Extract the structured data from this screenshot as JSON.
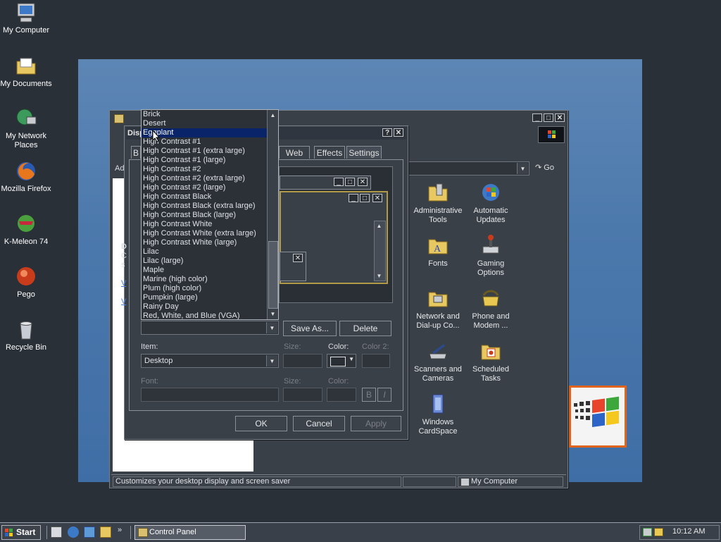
{
  "desktop": {
    "icons": [
      {
        "label": "My Computer",
        "icon": "my-computer-icon"
      },
      {
        "label": "My Documents",
        "icon": "my-documents-icon"
      },
      {
        "label": "My Network Places",
        "icon": "network-places-icon"
      },
      {
        "label": "Mozilla Firefox",
        "icon": "firefox-icon"
      },
      {
        "label": "K-Meleon 74",
        "icon": "k-meleon-icon"
      },
      {
        "label": "Pego",
        "icon": "pego-icon"
      },
      {
        "label": "Recycle Bin",
        "icon": "recycle-bin-icon"
      }
    ]
  },
  "control_panel": {
    "title": "Control Panel",
    "address_go": "Go",
    "address_label": "Ad",
    "icons": [
      {
        "label": "Administrative Tools",
        "icon": "admin-tools-icon"
      },
      {
        "label": "Automatic Updates",
        "icon": "automatic-updates-icon"
      },
      {
        "label": "Fonts",
        "icon": "fonts-icon"
      },
      {
        "label": "Gaming Options",
        "icon": "gaming-options-icon"
      },
      {
        "label": "Network and Dial-up Co...",
        "icon": "network-dialup-icon"
      },
      {
        "label": "Phone and Modem ...",
        "icon": "phone-modem-icon"
      },
      {
        "label": "Scanners and Cameras",
        "icon": "scanners-cameras-icon"
      },
      {
        "label": "Scheduled Tasks",
        "icon": "scheduled-tasks-icon"
      },
      {
        "label": "Windows CardSpace",
        "icon": "cardspace-icon"
      }
    ],
    "status_text": "Customizes your desktop display and screen saver",
    "status_zone": "My Computer"
  },
  "display_dialog": {
    "title": "Disp",
    "tabs": [
      "B",
      "Web",
      "Effects",
      "Settings"
    ],
    "scheme_list": {
      "selected": "Eggplant",
      "items": [
        "Brick",
        "Desert",
        "Eggplant",
        "High Contrast #1",
        "High Contrast #1 (extra large)",
        "High Contrast #1 (large)",
        "High Contrast #2",
        "High Contrast #2 (extra large)",
        "High Contrast #2 (large)",
        "High Contrast Black",
        "High Contrast Black (extra large)",
        "High Contrast Black (large)",
        "High Contrast White",
        "High Contrast White (extra large)",
        "High Contrast White (large)",
        "Lilac",
        "Lilac (large)",
        "Maple",
        "Marine (high color)",
        "Plum (high color)",
        "Pumpkin (large)",
        "Rainy Day",
        "Red, White, and Blue (VGA)"
      ]
    },
    "save_as": "Save As...",
    "delete": "Delete",
    "item_label": "Item:",
    "item_value": "Desktop",
    "size_label": "Size:",
    "color_label": "Color:",
    "color2_label": "Color 2:",
    "font_label": "Font:",
    "bold": "B",
    "italic": "I",
    "ok": "OK",
    "cancel": "Cancel",
    "apply": "Apply",
    "left_fragments": {
      "d": "D",
      "c": "C",
      "s": "s",
      "v1": "V",
      "v2": "V"
    }
  },
  "taskbar": {
    "start": "Start",
    "task": "Control Panel",
    "time": "10:12 AM"
  }
}
